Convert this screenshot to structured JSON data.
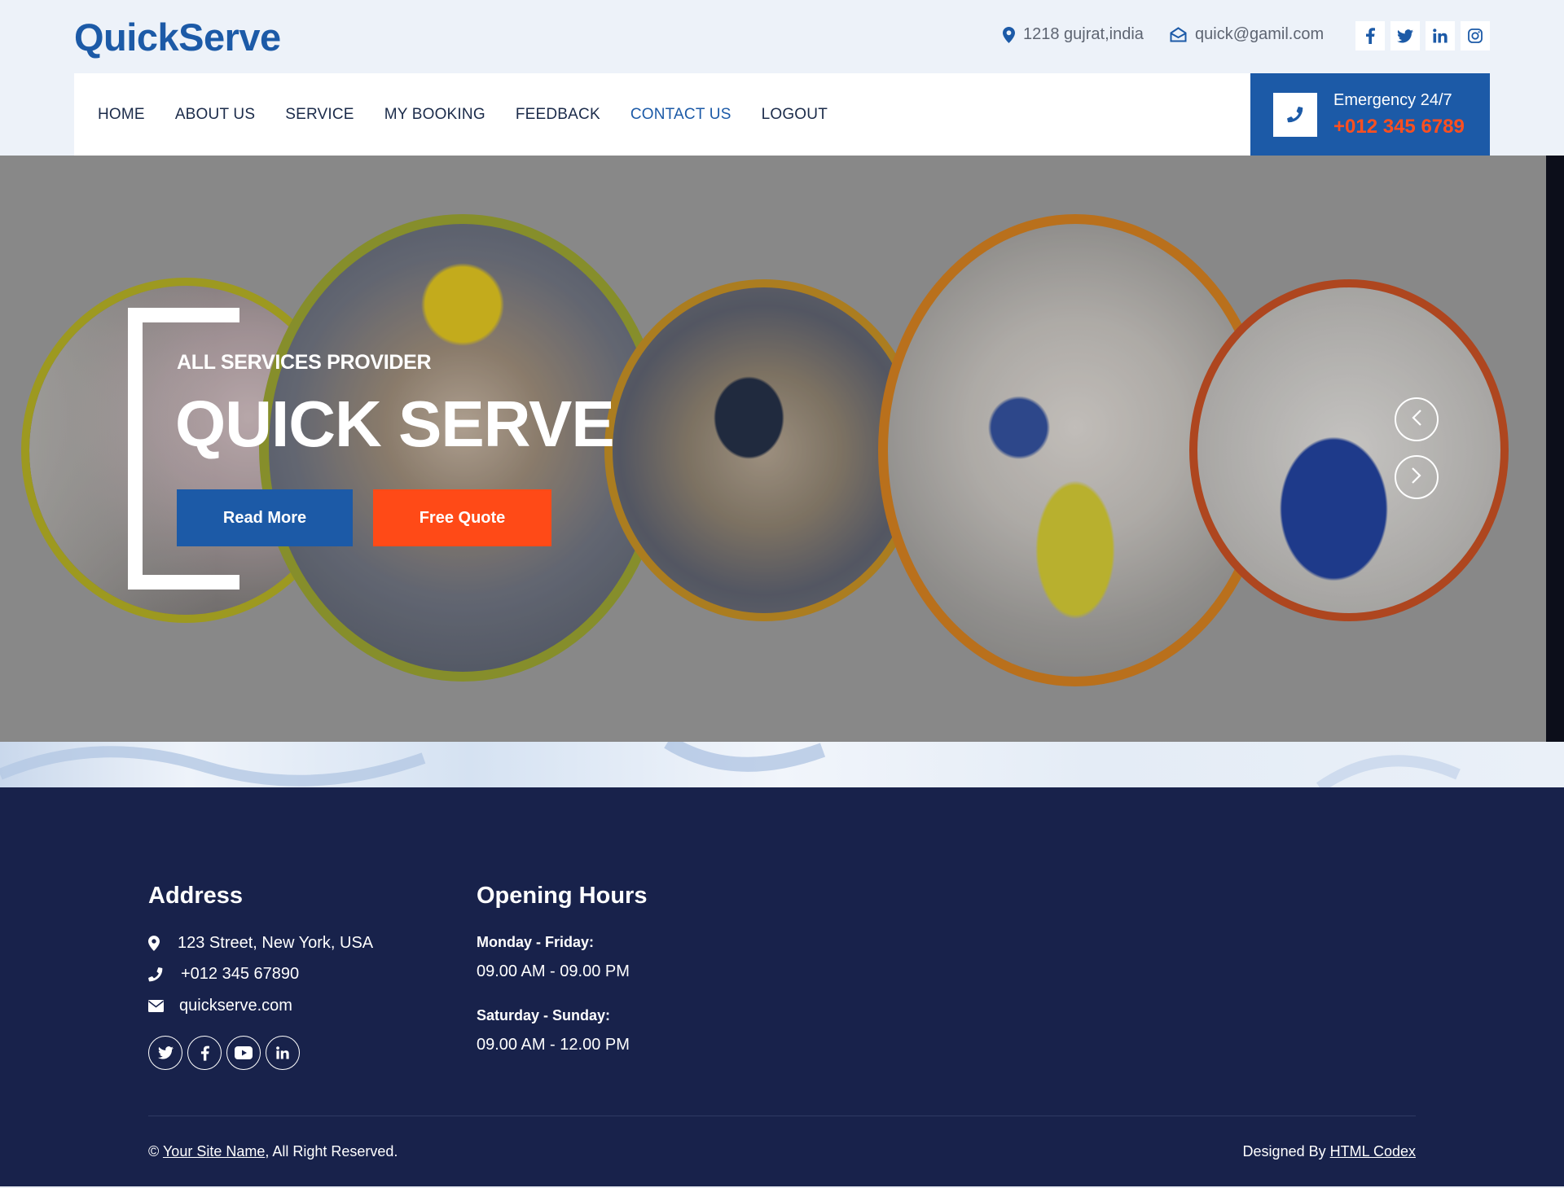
{
  "brand": "QuickServe",
  "topbar": {
    "address": "1218 gujrat,india",
    "email": "quick@gamil.com",
    "social": [
      {
        "icon": "facebook-icon",
        "glyph": "f"
      },
      {
        "icon": "twitter-icon",
        "glyph": "t"
      },
      {
        "icon": "linkedin-icon",
        "glyph": "in"
      },
      {
        "icon": "instagram-icon",
        "glyph": "ig"
      }
    ]
  },
  "nav": {
    "items": [
      {
        "label": "HOME",
        "active": false
      },
      {
        "label": "ABOUT US",
        "active": false
      },
      {
        "label": "SERVICE",
        "active": false
      },
      {
        "label": "MY BOOKING",
        "active": false
      },
      {
        "label": "FEEDBACK",
        "active": false
      },
      {
        "label": "CONTACT US",
        "active": true
      },
      {
        "label": "LOGOUT",
        "active": false
      }
    ],
    "emergency_label": "Emergency 24/7",
    "emergency_phone": "+012 345 6789"
  },
  "hero": {
    "subtitle": "ALL SERVICES PROVIDER",
    "title": "QUICK SERVE",
    "read_more": "Read More",
    "free_quote": "Free Quote"
  },
  "footer": {
    "address_heading": "Address",
    "address": "123 Street, New York, USA",
    "phone": "+012 345 67890",
    "email": "quickserve.com",
    "hours_heading": "Opening Hours",
    "weekday_label": "Monday - Friday:",
    "weekday_hours": "09.00 AM - 09.00 PM",
    "weekend_label": "Saturday - Sunday:",
    "weekend_hours": "09.00 AM - 12.00 PM",
    "copyright_prefix": "©",
    "copyright_link": "Your Site Name",
    "copyright_suffix": ", All Right Reserved.",
    "designed_by": "Designed By",
    "designer_link": "HTML Codex"
  },
  "colors": {
    "brand_blue": "#1c5aa7",
    "accent_orange": "#ff4a17",
    "footer_navy": "#18224b"
  }
}
